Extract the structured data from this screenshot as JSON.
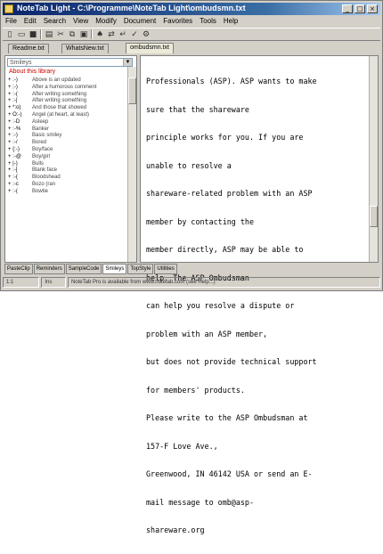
{
  "window": {
    "title": "NoteTab Light - C:\\Programme\\NoteTab Light\\ombudsmn.txt",
    "controls": [
      "_",
      "□",
      "×"
    ]
  },
  "menu": [
    "File",
    "Edit",
    "Search",
    "View",
    "Modify",
    "Document",
    "Favorites",
    "Tools",
    "Help"
  ],
  "toolbar": [
    "new-icon",
    "open-icon",
    "save-icon",
    "print-icon",
    "cut-icon",
    "copy-icon",
    "paste-icon",
    "find-icon",
    "replace-icon",
    "wrap-icon",
    "spell-icon",
    "options-icon"
  ],
  "file_tabs": [
    {
      "label": "Readme.txt",
      "active": false
    },
    {
      "label": "WhatsNew.txt",
      "active": false
    },
    {
      "label": "ombudsmn.txt",
      "active": true
    }
  ],
  "left_pane": {
    "select_value": "Smileys",
    "header": "About this library",
    "rows": [
      {
        "key": "+ :-)",
        "text": "Above is an updated"
      },
      {
        "key": "+ ;-)",
        "text": "After a humorous comment"
      },
      {
        "key": "+ :-(",
        "text": "After writing something"
      },
      {
        "key": "+ :-|",
        "text": "After writing something"
      },
      {
        "key": "+ *:o)",
        "text": "And those that showed"
      },
      {
        "key": "+ O:-)",
        "text": "Angel (at heart, at least)"
      },
      {
        "key": "+ :-D",
        "text": "Asleep"
      },
      {
        "key": "+ :-%",
        "text": "Banker"
      },
      {
        "key": "+ :-)",
        "text": "Basic smiley"
      },
      {
        "key": "+ :-/",
        "text": "Bored"
      },
      {
        "key": "+ {:-)",
        "text": "Boy/face"
      },
      {
        "key": "+ :-@",
        "text": "Boy/girl"
      },
      {
        "key": "+ |-)",
        "text": "Bulls"
      },
      {
        "key": "+ :-[",
        "text": "Blank face"
      },
      {
        "key": "+ :-{",
        "text": "Bloodshead"
      },
      {
        "key": "+ :-c",
        "text": "Bozo (ran"
      },
      {
        "key": "+ :-(",
        "text": "Bowtie"
      }
    ]
  },
  "editor": {
    "lines": [
      "Professionals (ASP). ASP wants to make",
      "sure that the shareware",
      "principle works for you. If you are",
      "unable to resolve a",
      "shareware-related problem with an ASP",
      "member by contacting the",
      "member directly, ASP may be able to",
      "help. The ASP Ombudsman",
      "can help you resolve a dispute or",
      "problem with an ASP member,",
      "but does not provide technical support",
      "for members' products.",
      "Please write to the ASP Ombudsman at",
      "157-F Love Ave.,",
      "Greenwood, IN 46142 USA or send an E-",
      "mail message to omb@asp-",
      "shareware.org"
    ]
  },
  "clip_tabs": [
    {
      "label": "PasteClip",
      "active": false
    },
    {
      "label": "Reminders",
      "active": false
    },
    {
      "label": "SampleCode",
      "active": false
    },
    {
      "label": "Smileys",
      "active": true
    },
    {
      "label": "TopStyle",
      "active": false
    },
    {
      "label": "Utilities",
      "active": false
    }
  ],
  "status": [
    "1:1",
    "Ins",
    "NoteTab Pro is available from www.notetab.com (see Help...)"
  ]
}
